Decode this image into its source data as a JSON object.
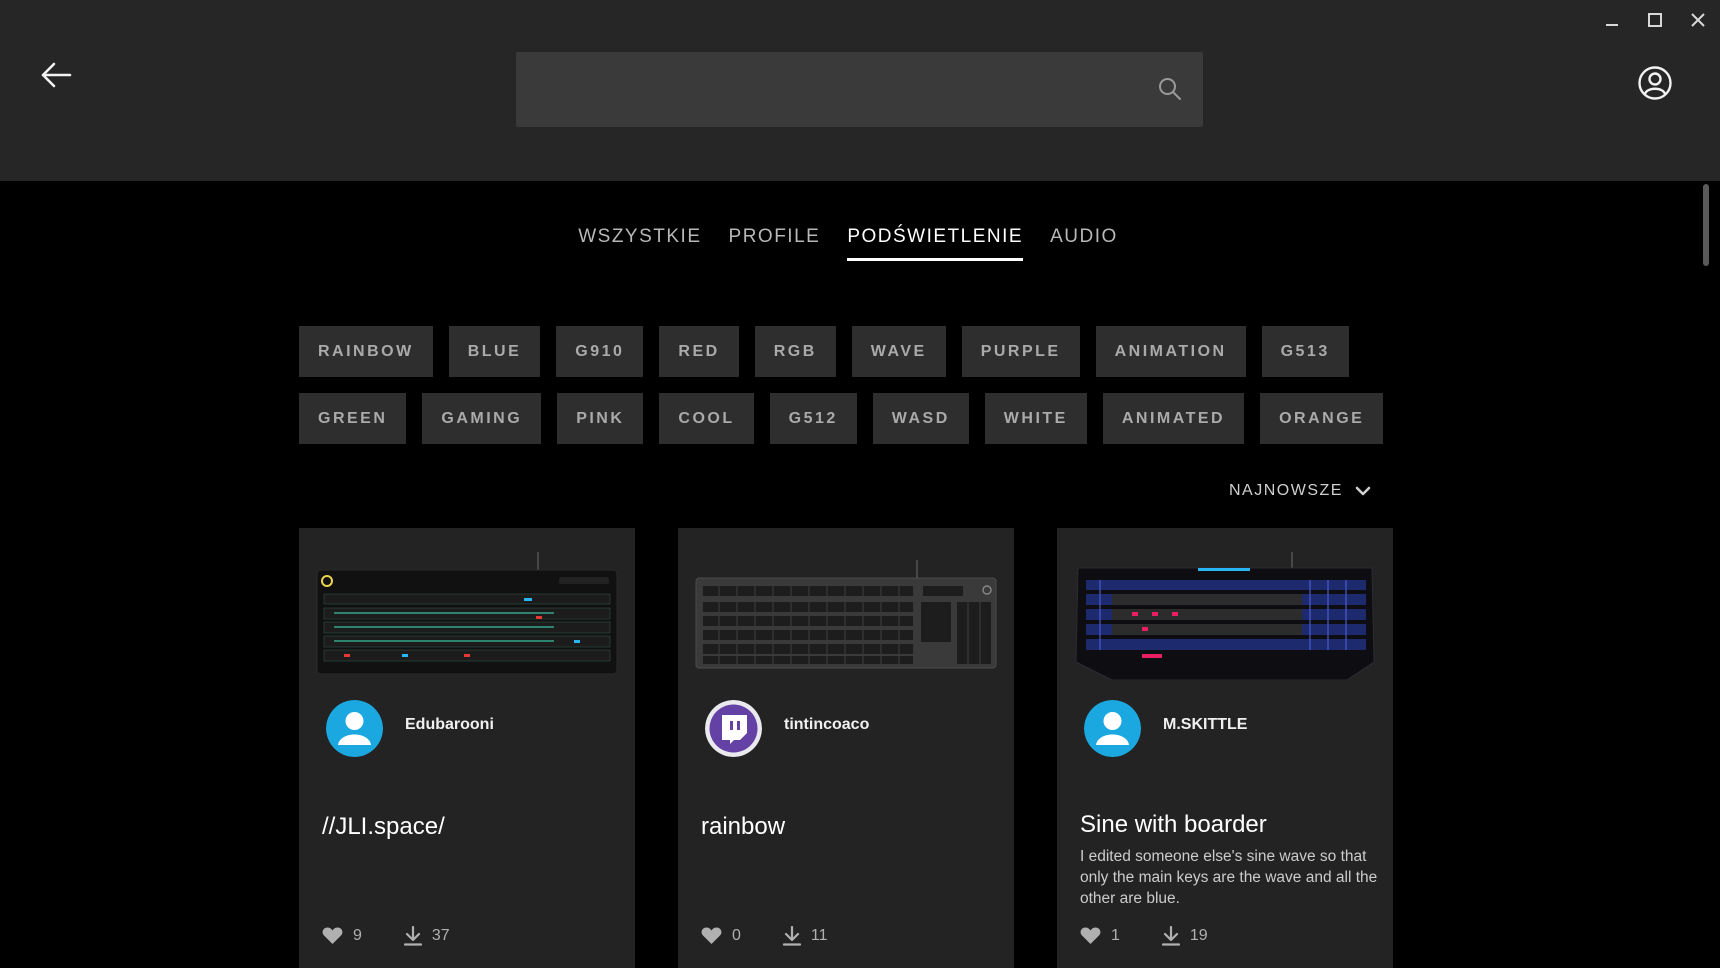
{
  "window": {
    "controls": [
      "minimize",
      "maximize",
      "close"
    ]
  },
  "header": {
    "search_placeholder": "",
    "icons": [
      "back-arrow-icon",
      "search-icon",
      "user-account-icon"
    ]
  },
  "tabs": [
    {
      "label": "WSZYSTKIE",
      "active": false
    },
    {
      "label": "PROFILE",
      "active": false
    },
    {
      "label": "PODŚWIETLENIE",
      "active": true
    },
    {
      "label": "AUDIO",
      "active": false
    }
  ],
  "tags": {
    "row1": [
      "RAINBOW",
      "BLUE",
      "G910",
      "RED",
      "RGB",
      "WAVE",
      "PURPLE",
      "ANIMATION",
      "G513"
    ],
    "row2": [
      "GREEN",
      "GAMING",
      "PINK",
      "COOL",
      "G512",
      "WASD",
      "WHITE",
      "ANIMATED",
      "ORANGE"
    ]
  },
  "sort": {
    "label": "NAJNOWSZE"
  },
  "cards": [
    {
      "username": "Edubarooni",
      "title": "//JLI.space/",
      "description": "",
      "likes": "9",
      "downloads": "37",
      "avatar": "default-user",
      "keyboard": "G513 RGB keyboard"
    },
    {
      "username": "tintincoaco",
      "title": "rainbow",
      "description": "",
      "likes": "0",
      "downloads": "11",
      "avatar": "twitch",
      "keyboard": "G512 keyboard"
    },
    {
      "username": "M.SKITTLE",
      "title": "Sine with boarder",
      "description": "I edited someone else's sine wave so that only the main keys are the wave and all the other are blue.",
      "likes": "1",
      "downloads": "19",
      "avatar": "default-user",
      "keyboard": "G910 keyboard"
    }
  ],
  "colors": {
    "header_bg": "#262626",
    "page_bg": "#000000",
    "card_bg": "#232323",
    "tag_bg": "#2e2e2e",
    "avatar_blue": "#1ba8e0",
    "twitch_purple": "#6441a4"
  }
}
